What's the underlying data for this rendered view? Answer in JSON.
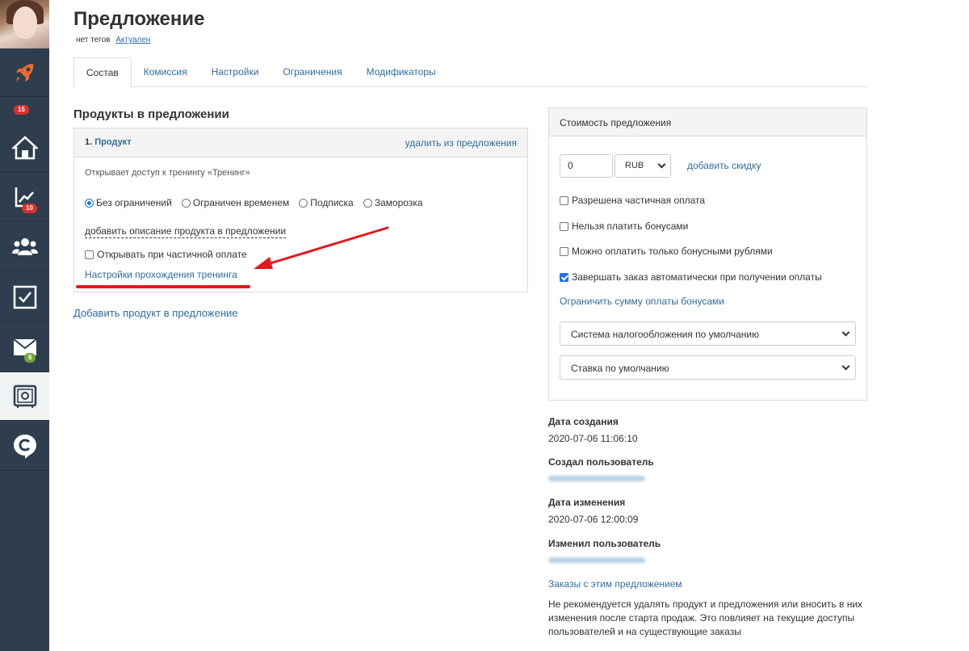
{
  "sidebar": {
    "badges": {
      "rocket": "15",
      "stats": "10",
      "mail": "6"
    }
  },
  "header": {
    "title": "Предложение",
    "tags": "нет тегов",
    "status": "Актуален"
  },
  "tabs": [
    {
      "label": "Состав",
      "active": true
    },
    {
      "label": "Комиссия"
    },
    {
      "label": "Настройки"
    },
    {
      "label": "Ограничения"
    },
    {
      "label": "Модификаторы"
    }
  ],
  "products": {
    "title": "Продукты в предложении",
    "item": {
      "number": "1.",
      "name": "Продукт",
      "remove_label": "удалить из предложения",
      "opens_text": "Открывает доступ к тренингу «Тренинг»",
      "access_options": [
        {
          "label": "Без ограничений",
          "selected": true
        },
        {
          "label": "Ограничен временем",
          "selected": false
        },
        {
          "label": "Подписка",
          "selected": false
        },
        {
          "label": "Заморозка",
          "selected": false
        }
      ],
      "add_description": "добавить описание продукта в предложении",
      "open_on_partial": "Открывать при частичной оплате",
      "training_settings": "Настройки прохождения тренинга"
    },
    "add_product": "Добавить продукт в предложение"
  },
  "cost": {
    "title": "Стоимость предложения",
    "price": "0",
    "currency": "RUB",
    "add_discount": "добавить скидку",
    "options": [
      {
        "label": "Разрешена частичная оплата",
        "checked": false
      },
      {
        "label": "Нельзя платить бонусами",
        "checked": false
      },
      {
        "label": "Можно оплатить только бонусными рублями",
        "checked": false
      },
      {
        "label": "Завершать заказ автоматически при получении оплаты",
        "checked": true
      }
    ],
    "limit_bonus": "Ограничить сумму оплаты бонусами",
    "tax_system": "Система налогообложения по умолчанию",
    "rate": "Ставка по умолчанию"
  },
  "meta": {
    "created_label": "Дата создания",
    "created_value": "2020-07-06 11:06:10",
    "creator_label": "Создал пользователь",
    "modified_label": "Дата изменения",
    "modified_value": "2020-07-06 12:00:09",
    "modifier_label": "Изменил пользователь",
    "orders_link": "Заказы с этим предложением",
    "warning": "Не рекомендуется удалять продукт и предложения или вносить в них изменения после старта продаж. Это повлияет на текущие доступы пользователей и на существующие заказы"
  }
}
